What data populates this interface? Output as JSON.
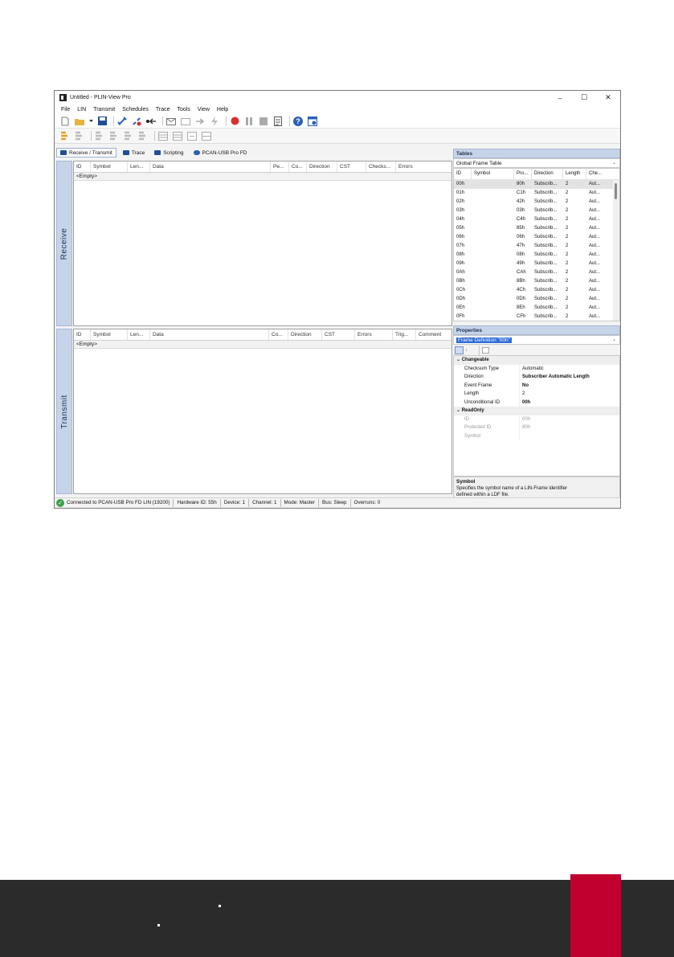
{
  "window": {
    "title": "Untitled - PLIN-View Pro",
    "controls": [
      "–",
      "☐",
      "✕"
    ]
  },
  "menu": [
    "File",
    "LIN",
    "Transmit",
    "Schedules",
    "Trace",
    "Tools",
    "View",
    "Help"
  ],
  "tabs": [
    "Receive / Transmit",
    "Trace",
    "Scripting",
    "PCAN-USB Pro FD"
  ],
  "receive": {
    "label": "Receive",
    "columns": [
      "ID",
      "Symbol",
      "Len...",
      "Data",
      "Pe...",
      "Co...",
      "Direction",
      "CST",
      "Checks...",
      "Errors"
    ],
    "empty": "<Empty>"
  },
  "transmit": {
    "label": "Transmit",
    "columns": [
      "ID",
      "Symbol",
      "Len...",
      "Data",
      "Co...",
      "Direction",
      "CST",
      "Errors",
      "Trig...",
      "Comment"
    ],
    "empty": "<Empty>"
  },
  "tables": {
    "title": "Tables",
    "selected": "Global Frame Table",
    "columns": [
      "ID",
      "Symbol",
      "Pro...",
      "Direction",
      "Length",
      "Che..."
    ],
    "rows": [
      [
        "00h",
        "",
        "80h",
        "Subscrib...",
        "2",
        "Aut..."
      ],
      [
        "01h",
        "",
        "C1h",
        "Subscrib...",
        "2",
        "Aut..."
      ],
      [
        "02h",
        "",
        "42h",
        "Subscrib...",
        "2",
        "Aut..."
      ],
      [
        "03h",
        "",
        "03h",
        "Subscrib...",
        "2",
        "Aut..."
      ],
      [
        "04h",
        "",
        "C4h",
        "Subscrib...",
        "2",
        "Aut..."
      ],
      [
        "05h",
        "",
        "85h",
        "Subscrib...",
        "2",
        "Aut..."
      ],
      [
        "06h",
        "",
        "06h",
        "Subscrib...",
        "2",
        "Aut..."
      ],
      [
        "07h",
        "",
        "47h",
        "Subscrib...",
        "2",
        "Aut..."
      ],
      [
        "08h",
        "",
        "08h",
        "Subscrib...",
        "2",
        "Aut..."
      ],
      [
        "09h",
        "",
        "49h",
        "Subscrib...",
        "2",
        "Aut..."
      ],
      [
        "0Ah",
        "",
        "CAh",
        "Subscrib...",
        "2",
        "Aut..."
      ],
      [
        "0Bh",
        "",
        "8Bh",
        "Subscrib...",
        "2",
        "Aut..."
      ],
      [
        "0Ch",
        "",
        "4Ch",
        "Subscrib...",
        "2",
        "Aut..."
      ],
      [
        "0Dh",
        "",
        "0Dh",
        "Subscrib...",
        "2",
        "Aut..."
      ],
      [
        "0Eh",
        "",
        "8Eh",
        "Subscrib...",
        "2",
        "Aut..."
      ],
      [
        "0Fh",
        "",
        "CFh",
        "Subscrib...",
        "2",
        "Aut..."
      ]
    ]
  },
  "properties": {
    "title": "Properties",
    "selected": "Frame Definition \"00h\"",
    "cat_changeable": "Changeable",
    "changeable": [
      [
        "Checksum Type",
        "Automatic"
      ],
      [
        "Direction",
        "Subscriber Automatic Length"
      ],
      [
        "Event Frame",
        "No"
      ],
      [
        "Length",
        "2"
      ],
      [
        "Unconditional ID",
        "00h"
      ]
    ],
    "cat_readonly": "ReadOnly",
    "readonly": [
      [
        "ID",
        "00h"
      ],
      [
        "Protected ID",
        "80h"
      ],
      [
        "Symbol",
        ""
      ]
    ],
    "desc_title": "Symbol",
    "desc_text": "Specifies the symbol name of a LIN-Frame identifier defined within a LDF file."
  },
  "status": [
    "Connected to PCAN-USB Pro FD LIN (19200)",
    "Hardware ID: 55h",
    "Device: 1",
    "Channel: 1",
    "Mode: Master",
    "Bus: Sleep",
    "Overruns: 0"
  ],
  "colors": {
    "accent": "#c1002f",
    "footer": "#2b2b2b",
    "panel": "#c6d4ea",
    "record": "#d93030"
  }
}
